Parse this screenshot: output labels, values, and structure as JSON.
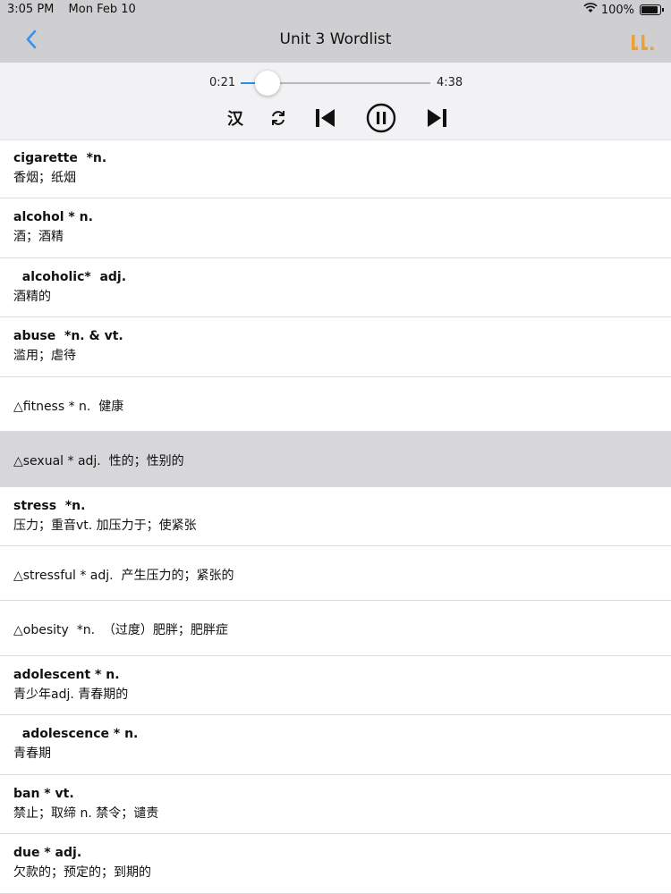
{
  "status": {
    "time": "3:05 PM",
    "date": "Mon Feb 10",
    "battery": "100%"
  },
  "nav": {
    "title": "Unit 3 Wordlist",
    "back_icon": "chevron-left-icon",
    "menu_icon": "bars-chart-icon"
  },
  "player": {
    "current_time": "0:21",
    "total_time": "4:38",
    "progress": 0.076,
    "lang_label": "汉"
  },
  "colors": {
    "accent": "#2f8cf2",
    "orange": "#f0a030",
    "bar_bg": "#cfcfd1",
    "highlight": "#d7d7d9"
  },
  "words": [
    {
      "kind": "two",
      "head": "cigarette  *n.",
      "sub": "香烟；纸烟"
    },
    {
      "kind": "two",
      "head": "alcohol * n.",
      "sub": "酒；酒精"
    },
    {
      "kind": "two",
      "head": "  alcoholic*  adj.",
      "sub": "酒精的"
    },
    {
      "kind": "two",
      "head": "abuse  *n. & vt.",
      "sub": "滥用；虐待"
    },
    {
      "kind": "one",
      "text": "△fitness * n.  健康"
    },
    {
      "kind": "one",
      "text": "△sexual * adj.  性的；性别的",
      "highlighted": true
    },
    {
      "kind": "two",
      "head": "stress  *n.",
      "sub": "压力；重音vt.  加压力于；使紧张"
    },
    {
      "kind": "one",
      "text": "△stressful * adj.  产生压力的；紧张的"
    },
    {
      "kind": "one",
      "text": "△obesity  *n.  （过度）肥胖；肥胖症"
    },
    {
      "kind": "two",
      "head": "adolescent * n.",
      "sub": "青少年adj.  青春期的"
    },
    {
      "kind": "two",
      "head": "  adolescence * n.",
      "sub": "青春期"
    },
    {
      "kind": "two",
      "head": "ban * vt.",
      "sub": "禁止；取缔 n.  禁令；谴责"
    },
    {
      "kind": "two",
      "head": "due * adj.",
      "sub": "欠款的；预定的；到期的"
    }
  ]
}
